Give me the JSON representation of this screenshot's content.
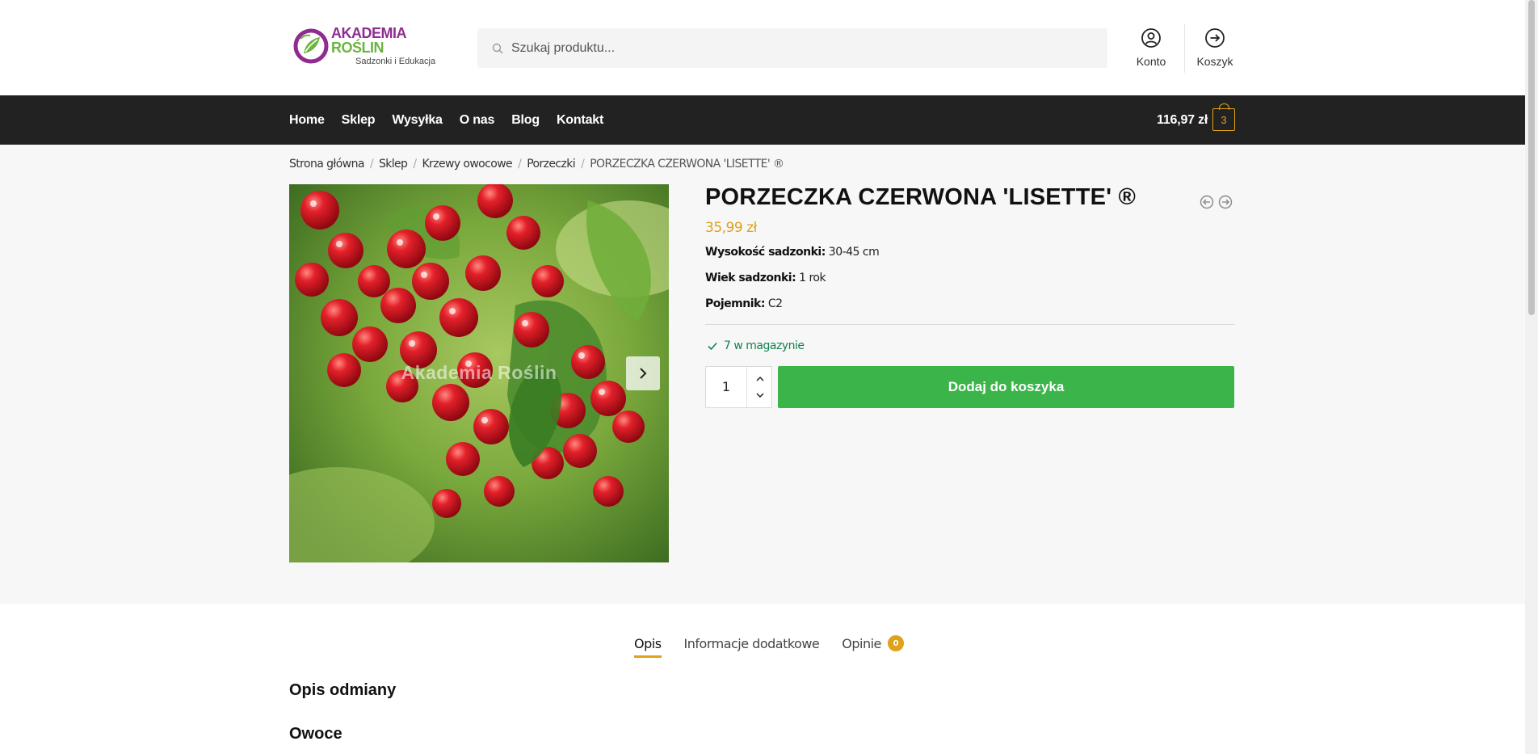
{
  "brand": {
    "name_part1": "AKADEMIA",
    "name_part2": "ROŚLIN",
    "tagline": "Sadzonki i Edukacja",
    "purple": "#8e2d8f",
    "green": "#6db33f"
  },
  "search": {
    "placeholder": "Szukaj produktu...",
    "icon": "search-icon"
  },
  "header_links": [
    {
      "label": "Konto",
      "icon": "user-circle-icon"
    },
    {
      "label": "Koszyk",
      "icon": "arrow-right-circle-icon"
    }
  ],
  "nav": {
    "items": [
      "Home",
      "Sklep",
      "Wysyłka",
      "O nas",
      "Blog",
      "Kontakt"
    ],
    "cart_total": "116,97 zł",
    "cart_count": "3",
    "bg": "#222222"
  },
  "breadcrumb": [
    "Strona główna",
    "Sklep",
    "Krzewy owocowe",
    "Porzeczki",
    "PORZECZKA CZERWONA 'LISETTE' ®"
  ],
  "product": {
    "title": "PORZECZKA CZERWONA 'LISETTE' ®",
    "price": "35,99 zł",
    "attributes": [
      {
        "label": "Wysokość sadzonki:",
        "value": "30-45 cm"
      },
      {
        "label": "Wiek sadzonki:",
        "value": "1 rok"
      },
      {
        "label": "Pojemnik:",
        "value": "C2"
      }
    ],
    "stock": "7 w magazynie",
    "quantity": "1",
    "add_to_cart": "Dodaj do koszyka",
    "image_watermark": "Akademia Roślin",
    "accent": "#e0a11b",
    "button_color": "#3bb54a",
    "stock_color": "#0f834d"
  },
  "tabs": [
    {
      "label": "Opis",
      "active": true
    },
    {
      "label": "Informacje dodatkowe",
      "active": false
    },
    {
      "label": "Opinie",
      "count": "0",
      "active": false
    }
  ],
  "content": {
    "heading1": "Opis odmiany",
    "heading2": "Owoce"
  }
}
